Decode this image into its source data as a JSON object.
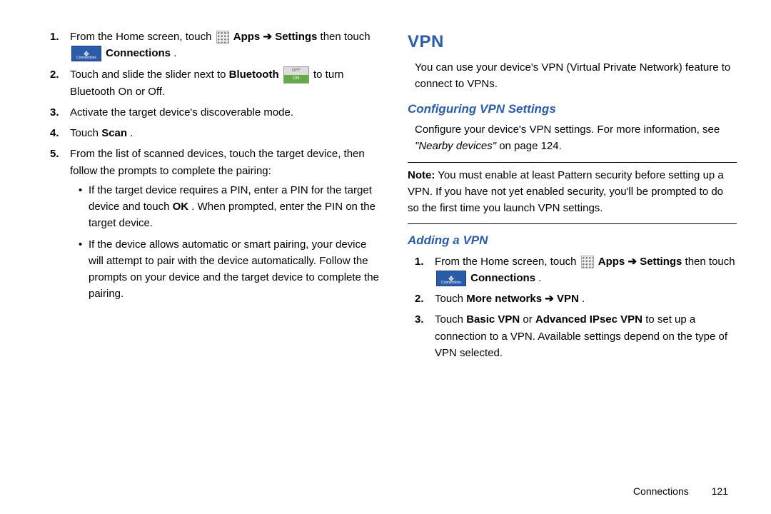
{
  "left": {
    "step1_a": "From the Home screen, touch ",
    "step1_apps": "Apps",
    "step1_arrow": " ➔ ",
    "step1_settings": "Settings",
    "step1_b": " then touch ",
    "step1_conn": "Connections",
    "step1_period": ".",
    "step2_a": "Touch and slide the slider next to ",
    "step2_bt": "Bluetooth",
    "step2_b": " to turn Bluetooth On or Off.",
    "step3": "Activate the target device's discoverable mode.",
    "step4_a": "Touch ",
    "step4_scan": "Scan",
    "step4_period": ".",
    "step5": "From the list of scanned devices, touch the target device, then follow the prompts to complete the pairing:",
    "bullet1_a": "If the target device requires a PIN, enter a PIN for the target device and touch ",
    "bullet1_ok": "OK",
    "bullet1_b": ". When prompted, enter the PIN on the target device.",
    "bullet2": "If the device allows automatic or smart pairing, your device will attempt to pair with the device automatically. Follow the prompts on your device and the target device to complete the pairing."
  },
  "right": {
    "vpn_title": "VPN",
    "vpn_intro": "You can use your device's VPN (Virtual Private Network) feature to connect to VPNs.",
    "conf_head": "Configuring VPN Settings",
    "conf_a": "Configure your device's VPN settings. For more information, see ",
    "conf_ref": "\"Nearby devices\"",
    "conf_b": " on page 124.",
    "note_label": "Note:",
    "note_body": " You must enable at least Pattern security before setting up a VPN. If you have not yet enabled security, you'll be prompted to do so the first time you launch VPN settings.",
    "add_head": "Adding a VPN",
    "add1_a": "From the Home screen, touch ",
    "add1_apps": "Apps",
    "add1_arrow": " ➔ ",
    "add1_settings": "Settings",
    "add1_b": " then touch ",
    "add1_conn": "Connections",
    "add1_period": ".",
    "add2_a": "Touch ",
    "add2_more": "More networks",
    "add2_arrow": " ➔ ",
    "add2_vpn": "VPN",
    "add2_period": ".",
    "add3_a": "Touch ",
    "add3_basic": "Basic VPN",
    "add3_or": " or ",
    "add3_adv": "Advanced IPsec VPN",
    "add3_b": " to set up a connection to a VPN. Available settings depend on the type of VPN selected."
  },
  "footer": {
    "section": "Connections",
    "page": "121"
  }
}
